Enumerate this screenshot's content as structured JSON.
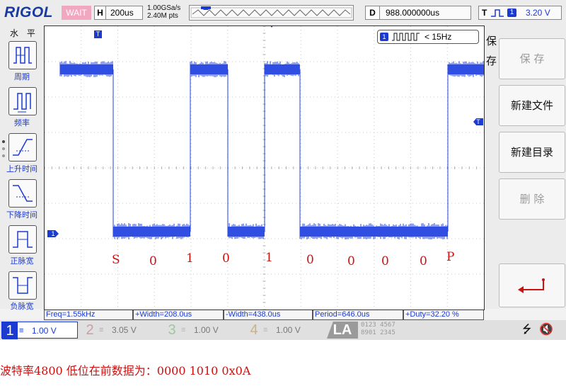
{
  "brand": "RIGOL",
  "run_state": "WAIT",
  "timebase": {
    "label": "H",
    "value": "200us"
  },
  "sample": {
    "rate": "1.00GSa/s",
    "points": "2.40M pts"
  },
  "delay": {
    "label": "D",
    "value": "988.000000us"
  },
  "trigger": {
    "label": "T",
    "channel": "1",
    "level": "3.20 V"
  },
  "freq_counter": {
    "channel": "1",
    "value": "< 15Hz"
  },
  "left_menu": {
    "title": "水 平",
    "items": [
      {
        "label": "周期",
        "icon": "period-icon"
      },
      {
        "label": "频率",
        "icon": "frequency-icon"
      },
      {
        "label": "上升时间",
        "icon": "rise-time-icon"
      },
      {
        "label": "下降时间",
        "icon": "fall-time-icon"
      },
      {
        "label": "正脉宽",
        "icon": "positive-width-icon"
      },
      {
        "label": "负脉宽",
        "icon": "negative-width-icon"
      }
    ]
  },
  "right_menu": {
    "title": "保存",
    "items": [
      {
        "label": "保 存",
        "enabled": false
      },
      {
        "label": "新建文件",
        "enabled": true
      },
      {
        "label": "新建目录",
        "enabled": true
      },
      {
        "label": "删 除",
        "enabled": false
      }
    ]
  },
  "measurements": [
    "Freq=1.55kHz",
    "+Width=208.0us",
    "-Width=438.0us",
    "Period=646.0us",
    "+Duty=32.20 %"
  ],
  "channels": [
    {
      "num": "1",
      "scale": "1.00 V",
      "color": "#1b3ad0",
      "active": true
    },
    {
      "num": "2",
      "scale": "3.05 V",
      "color": "#c8a0a0",
      "active": false
    },
    {
      "num": "3",
      "scale": "1.00 V",
      "color": "#9fc79f",
      "active": false
    },
    {
      "num": "4",
      "scale": "1.00 V",
      "color": "#c9b28a",
      "active": false
    }
  ],
  "la": {
    "label": "LA",
    "bits_top": "0123 4567",
    "bits_bottom": "8901 2345"
  },
  "bit_labels": [
    "S",
    "0",
    "1",
    "0",
    "1",
    "0",
    "0",
    "0",
    "0",
    "P"
  ],
  "waveform": {
    "levels": [
      "high",
      "low",
      "high",
      "low",
      "high",
      "low",
      "high"
    ],
    "color": "#2040e0"
  },
  "annotation": "波特率4800  低位在前数据为：0000 1010  0x0A",
  "colors": {
    "accent": "#1b3ad0",
    "label_red": "#cc1111"
  }
}
